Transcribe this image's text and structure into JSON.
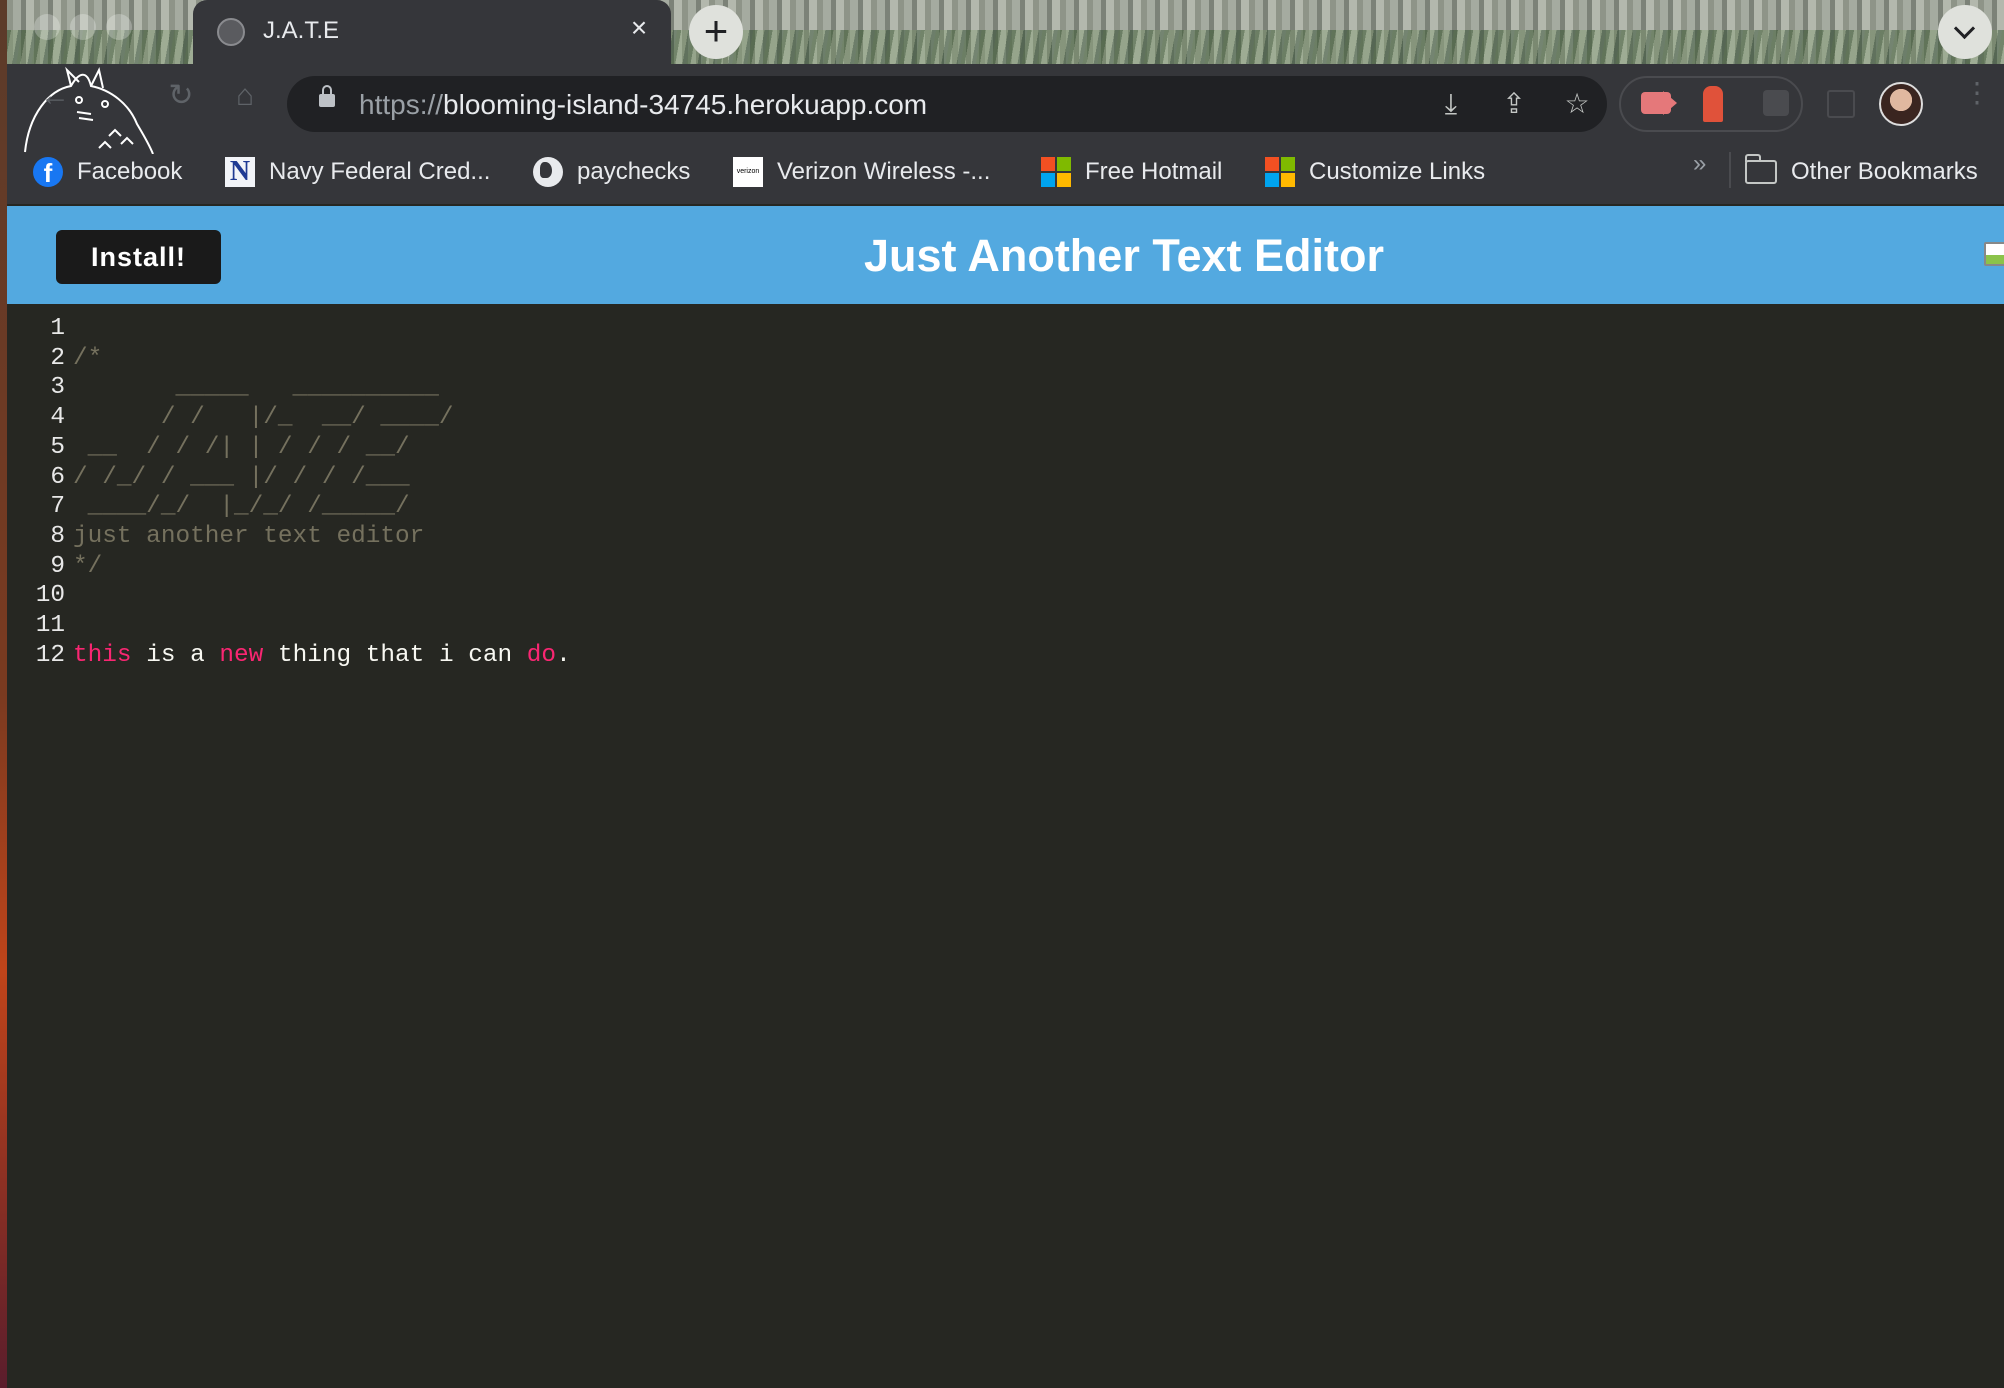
{
  "browser": {
    "tab": {
      "title": "J.A.T.E",
      "close_icon": "×"
    },
    "new_tab_icon": "+",
    "omnibox": {
      "url_scheme": "https://",
      "url_host": "blooming-island-34745.herokuapp.com"
    },
    "bookmarks": [
      {
        "label": "Facebook",
        "icon": "facebook-icon",
        "glyph": "f"
      },
      {
        "label": "Navy Federal Cred...",
        "icon": "nfcu-icon",
        "glyph": "N"
      },
      {
        "label": "paychecks",
        "icon": "globe-icon",
        "glyph": ""
      },
      {
        "label": "Verizon Wireless -...",
        "icon": "verizon-icon",
        "glyph": "verizon"
      },
      {
        "label": "Free Hotmail",
        "icon": "microsoft-icon",
        "glyph": ""
      },
      {
        "label": "Customize Links",
        "icon": "microsoft-icon",
        "glyph": ""
      }
    ],
    "bookmarks_overflow": "»",
    "other_bookmarks": "Other Bookmarks"
  },
  "app": {
    "install_label": "Install!",
    "title": "Just Another Text Editor"
  },
  "editor": {
    "lines": [
      {
        "num": "1",
        "segments": []
      },
      {
        "num": "2",
        "segments": [
          {
            "text": "/*",
            "kind": "comment"
          }
        ]
      },
      {
        "num": "3",
        "segments": [
          {
            "text": "       _____   __________",
            "kind": "comment"
          }
        ]
      },
      {
        "num": "4",
        "segments": [
          {
            "text": "      / /   |/_  __/ ____/",
            "kind": "comment"
          }
        ]
      },
      {
        "num": "5",
        "segments": [
          {
            "text": " __  / / /| | / / / __/",
            "kind": "comment"
          }
        ]
      },
      {
        "num": "6",
        "segments": [
          {
            "text": "/ /_/ / ___ |/ / / /___",
            "kind": "comment"
          }
        ]
      },
      {
        "num": "7",
        "segments": [
          {
            "text": " ____/_/  |_/_/ /_____/",
            "kind": "comment"
          }
        ]
      },
      {
        "num": "8",
        "segments": [
          {
            "text": "just another text editor",
            "kind": "comment"
          }
        ]
      },
      {
        "num": "9",
        "segments": [
          {
            "text": "*/",
            "kind": "comment"
          }
        ]
      },
      {
        "num": "10",
        "segments": []
      },
      {
        "num": "11",
        "segments": []
      },
      {
        "num": "12",
        "segments": [
          {
            "text": "this",
            "kind": "kw"
          },
          {
            "text": " is a ",
            "kind": "plain"
          },
          {
            "text": "new",
            "kind": "kw"
          },
          {
            "text": " thing that i can ",
            "kind": "plain"
          },
          {
            "text": "do",
            "kind": "kw"
          },
          {
            "text": ".",
            "kind": "plain"
          }
        ]
      }
    ]
  }
}
